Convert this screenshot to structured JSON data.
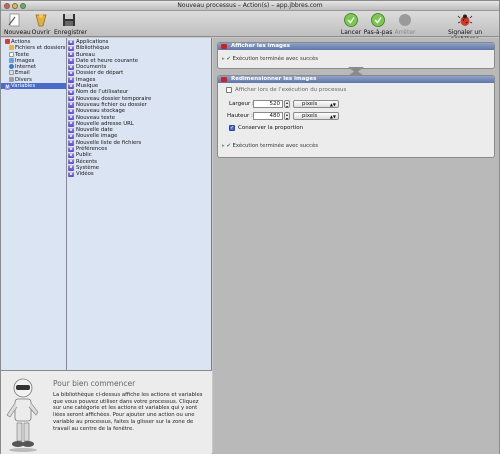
{
  "window": {
    "title": "Nouveau processus – Action(s) – app.jbbres.com"
  },
  "toolbar": {
    "new_label": "Nouveau",
    "open_label": "Ouvrir",
    "save_label": "Enregistrer",
    "run_label": "Lancer",
    "step_label": "Pas-à-pas",
    "stop_label": "Arrêter",
    "report_label": "Signaler un problème"
  },
  "categories": [
    {
      "label": "Actions",
      "icon": "actions-icon",
      "color": "#c84040"
    },
    {
      "label": "Fichiers et dossiers",
      "icon": "folder-icon",
      "color": "#e8b44a"
    },
    {
      "label": "Texte",
      "icon": "text-icon",
      "color": "#ffffff"
    },
    {
      "label": "Images",
      "icon": "image-icon",
      "color": "#70a0d0"
    },
    {
      "label": "Internet",
      "icon": "globe-icon",
      "color": "#3a7ad0"
    },
    {
      "label": "Email",
      "icon": "email-icon",
      "color": "#e0e0e0"
    },
    {
      "label": "Divers",
      "icon": "misc-icon",
      "color": "#a0a0a0"
    },
    {
      "label": "Variables",
      "icon": "variable-icon",
      "color": "#6a58cc",
      "selected": true
    }
  ],
  "variables": [
    "Applications",
    "Bibliothèque",
    "Bureau",
    "Date et heure courante",
    "Documents",
    "Dossier de départ",
    "Images",
    "Musique",
    "Nom de l’utilisateur",
    "Nouveau dossier temporaire",
    "Nouveau fichier ou dossier",
    "Nouveau stockage",
    "Nouveau texte",
    "Nouvelle adresse URL",
    "Nouvelle date",
    "Nouvelle image",
    "Nouvelle liste de fichiers",
    "Préférences",
    "Public",
    "Récents",
    "Système",
    "Vidéos"
  ],
  "description": {
    "title": "Pour bien commencer",
    "text": "La bibliothèque ci-dessus affiche les actions et variables que vous pouvez utiliser dans votre processus. Cliquez sur une catégorie et les actions et variables qui y sont liées seront affichées. Pour ajouter une action ou une variable au processus, faites la glisser sur la zone de travail au centre de la fenêtre."
  },
  "workflow": {
    "action1": {
      "title": "Afficher les images",
      "status": "Exécution terminée avec succès"
    },
    "action2": {
      "title": "Redimensionner les images",
      "show_on_run": "Afficher lors de l’exécution du processus",
      "width_label": "Largeur :",
      "width_value": "520",
      "width_unit": "pixels",
      "height_label": "Hauteur :",
      "height_value": "480",
      "height_unit": "pixels",
      "keep_ratio": "Conserver la proportion",
      "status": "Exécution terminée avec succès"
    }
  },
  "colors": {
    "accent": "#4a6cc8",
    "success": "#2a8a2a",
    "header": "#6a80b0"
  }
}
